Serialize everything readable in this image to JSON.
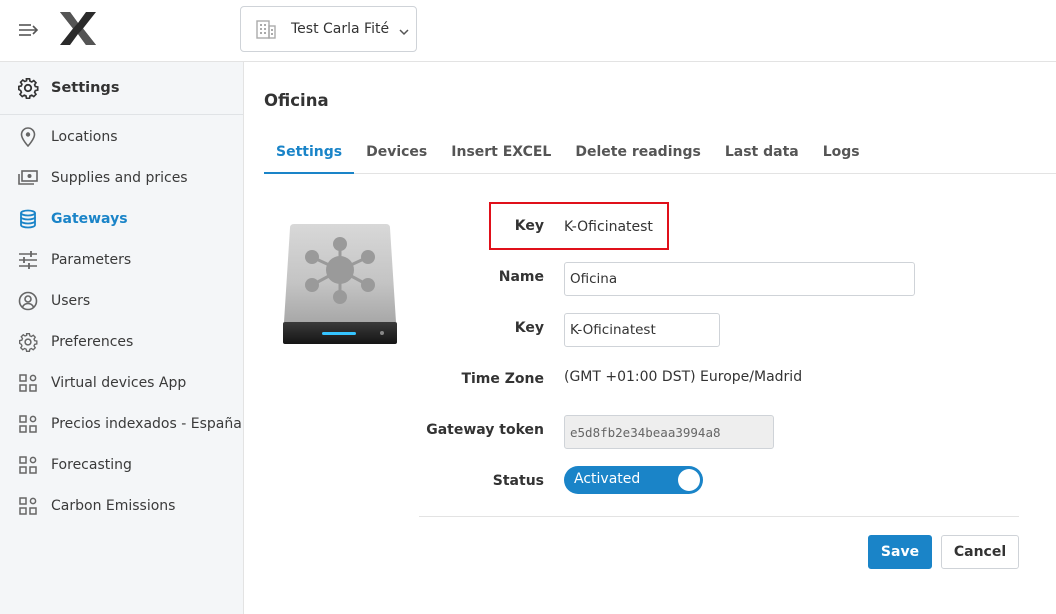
{
  "topbar": {
    "org_name": "Test Carla Fité"
  },
  "sidebar": {
    "header": "Settings",
    "items": [
      {
        "label": "Locations",
        "icon": "location-pin-icon"
      },
      {
        "label": "Supplies and prices",
        "icon": "money-icon"
      },
      {
        "label": "Gateways",
        "icon": "gateway-stack-icon",
        "active": true
      },
      {
        "label": "Parameters",
        "icon": "sliders-icon"
      },
      {
        "label": "Users",
        "icon": "user-icon"
      },
      {
        "label": "Preferences",
        "icon": "gear-icon"
      },
      {
        "label": "Virtual devices App",
        "icon": "apps-grid-icon"
      },
      {
        "label": "Precios indexados - España",
        "icon": "apps-grid-icon"
      },
      {
        "label": "Forecasting",
        "icon": "apps-grid-icon"
      },
      {
        "label": "Carbon Emissions",
        "icon": "apps-grid-icon"
      }
    ]
  },
  "main": {
    "title": "Oficina",
    "tabs": [
      {
        "label": "Settings",
        "active": true
      },
      {
        "label": "Devices"
      },
      {
        "label": "Insert EXCEL"
      },
      {
        "label": "Delete readings"
      },
      {
        "label": "Last data"
      },
      {
        "label": "Logs"
      }
    ],
    "form": {
      "key_label_top": "Key",
      "key_value_top": "K-Oficinatest",
      "name_label": "Name",
      "name_value": "Oficina",
      "key_label": "Key",
      "key_value": "K-Oficinatest",
      "timezone_label": "Time Zone",
      "timezone_value": "(GMT +01:00 DST) Europe/Madrid",
      "token_label": "Gateway token",
      "token_value": "e5d8fb2e34beaa3994a8",
      "status_label": "Status",
      "status_value": "Activated"
    },
    "buttons": {
      "save": "Save",
      "cancel": "Cancel"
    }
  },
  "colors": {
    "accent": "#1a84c8",
    "highlight": "#e0101a",
    "sidebar_bg": "#f4f6f8"
  }
}
